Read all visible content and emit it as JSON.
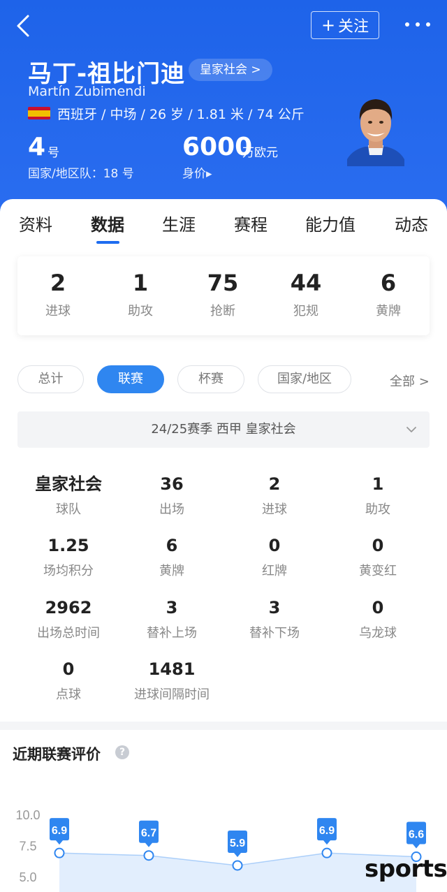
{
  "header": {
    "follow_label": "关注",
    "player_name_cn": "马丁-祖比门迪",
    "player_name_en": "Martín Zubimendi",
    "club_chip": "皇家社会 >",
    "meta": "西班牙 / 中场 / 26 岁 / 1.81 米 / 74 公斤",
    "shirt_number": "4",
    "shirt_unit": "号",
    "national_team_number": "国家/地区队：18 号",
    "market_value": "6000",
    "market_value_unit": "万欧元",
    "market_value_label": "身价▸",
    "flag_colors": [
      "#c8102e",
      "#f1bf00"
    ]
  },
  "tabs": [
    {
      "label": "资料"
    },
    {
      "label": "数据"
    },
    {
      "label": "生涯"
    },
    {
      "label": "赛程"
    },
    {
      "label": "能力值"
    },
    {
      "label": "动态"
    }
  ],
  "summary": [
    {
      "value": "2",
      "label": "进球"
    },
    {
      "value": "1",
      "label": "助攻"
    },
    {
      "value": "75",
      "label": "抢断"
    },
    {
      "value": "44",
      "label": "犯规"
    },
    {
      "value": "6",
      "label": "黄牌"
    }
  ],
  "filters": [
    {
      "label": "总计"
    },
    {
      "label": "联赛"
    },
    {
      "label": "杯赛"
    },
    {
      "label": "国家/地区"
    }
  ],
  "filter_all": "全部 >",
  "season": "24/25赛季 西甲 皇家社会",
  "stats": [
    {
      "value": "皇家社会",
      "label": "球队"
    },
    {
      "value": "36",
      "label": "出场"
    },
    {
      "value": "2",
      "label": "进球"
    },
    {
      "value": "1",
      "label": "助攻"
    },
    {
      "value": "1.25",
      "label": "场均积分"
    },
    {
      "value": "6",
      "label": "黄牌"
    },
    {
      "value": "0",
      "label": "红牌"
    },
    {
      "value": "0",
      "label": "黄变红"
    },
    {
      "value": "2962",
      "label": "出场总时间"
    },
    {
      "value": "3",
      "label": "替补上场"
    },
    {
      "value": "3",
      "label": "替补下场"
    },
    {
      "value": "0",
      "label": "乌龙球"
    },
    {
      "value": "0",
      "label": "点球"
    },
    {
      "value": "1481",
      "label": "进球间隔时间"
    }
  ],
  "rating": {
    "title": "近期联赛评价",
    "help": "?"
  },
  "chart_data": {
    "type": "area",
    "title": "近期联赛评价",
    "y_ticks": [
      "10.0",
      "7.5",
      "5.0"
    ],
    "ylim": [
      5.0,
      10.0
    ],
    "values": [
      6.9,
      6.7,
      5.9,
      6.9,
      6.6
    ],
    "data_labels": [
      "6.9",
      "6.7",
      "5.9",
      "6.9",
      "6.6"
    ],
    "accent": "#2f86f0"
  },
  "watermark": "sports"
}
